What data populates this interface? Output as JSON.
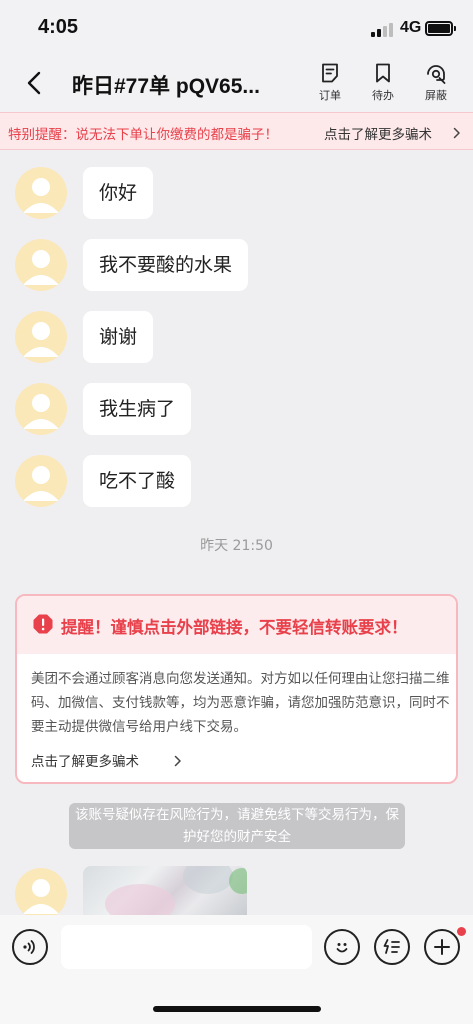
{
  "status_bar": {
    "time": "4:05",
    "network": "4G"
  },
  "nav": {
    "title": "昨日#77单 pQV65...",
    "actions": [
      {
        "label": "订单",
        "icon": "order-icon"
      },
      {
        "label": "待办",
        "icon": "bookmark-icon"
      },
      {
        "label": "屏蔽",
        "icon": "block-icon"
      }
    ]
  },
  "banner": {
    "warning": "特别提醒：说无法下单让你缴费的都是骗子！",
    "link": "点击了解更多骗术"
  },
  "messages": [
    {
      "text": "你好"
    },
    {
      "text": "我不要酸的水果"
    },
    {
      "text": "谢谢"
    },
    {
      "text": "我生病了"
    },
    {
      "text": "吃不了酸"
    }
  ],
  "timestamp": "昨天 21:50",
  "safety_card": {
    "title": "提醒！谨慎点击外部链接，不要轻信转账要求！",
    "body": "美团不会通过顾客消息向您发送通知。对方如以任何理由让您扫描二维码、加微信、支付钱款等，均为恶意诈骗，请您加强防范意识，同时不要主动提供微信号给用户线下交易。",
    "link": "点击了解更多骗术"
  },
  "risk_note": "该账号疑似存在风险行为，请避免线下等交易行为，保护好您的财产安全",
  "input_bar": {
    "placeholder": "",
    "left_icon": "voice-icon",
    "right_icons": [
      "emoji-icon",
      "quick-reply-icon",
      "plus-icon"
    ]
  },
  "colors": {
    "accent_red": "#e8414b",
    "banner_bg": "#fde8ea",
    "avatar_bg": "#fbe8b9",
    "page_bg": "#efeff1"
  }
}
